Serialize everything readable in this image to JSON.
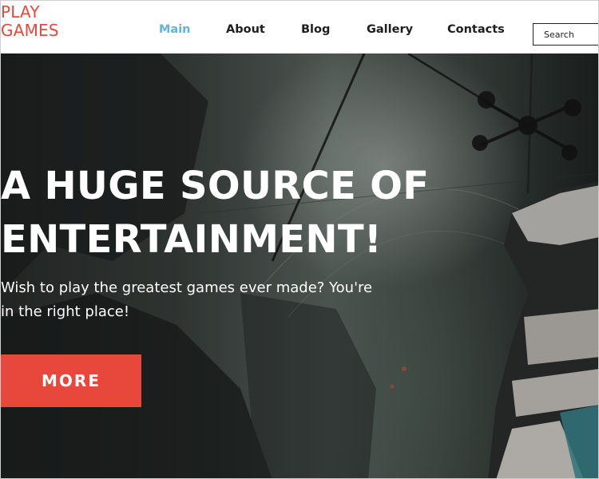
{
  "logo": {
    "line1": "PLAY",
    "line2": "GAMES"
  },
  "nav": {
    "items": [
      {
        "label": "Main",
        "active": true
      },
      {
        "label": "About",
        "active": false
      },
      {
        "label": "Blog",
        "active": false
      },
      {
        "label": "Gallery",
        "active": false
      },
      {
        "label": "Contacts",
        "active": false
      }
    ]
  },
  "search": {
    "placeholder": "Search",
    "value": ""
  },
  "hero": {
    "title_line1": "A HUGE SOURCE OF",
    "title_line2": "ENTERTAINMENT!",
    "subtitle_line1": "Wish to play the greatest games ever made? You're",
    "subtitle_line2": "in the right place!",
    "button_label": "MORE",
    "background_icon": "sci-fi-scene-image"
  },
  "colors": {
    "accent_red": "#e8483c",
    "nav_active_blue": "#5fb4df",
    "nav_text": "#1e1e1e"
  }
}
